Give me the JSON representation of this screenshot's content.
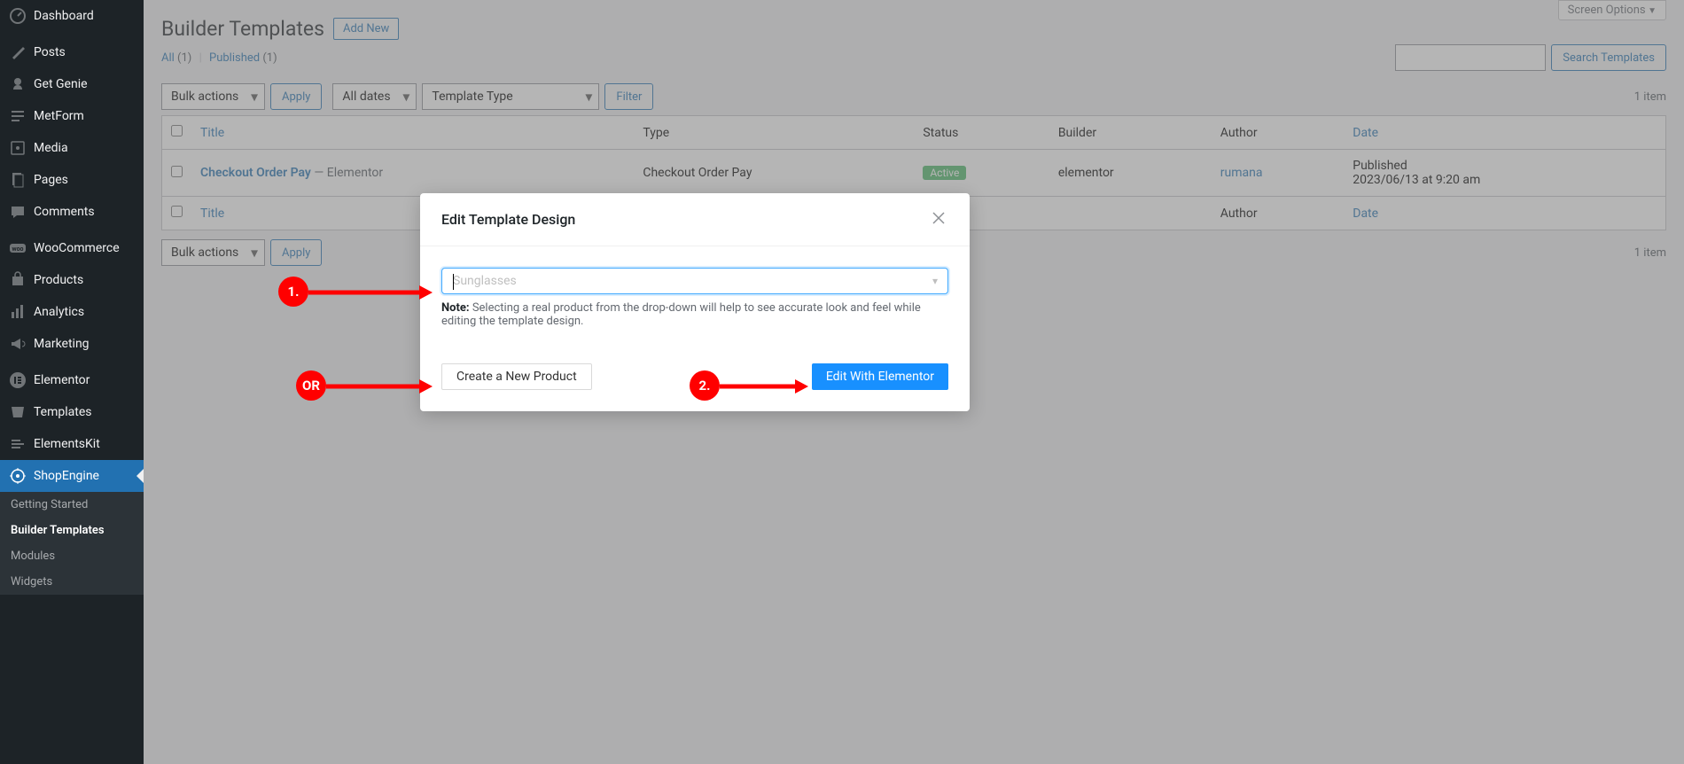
{
  "sidebar": {
    "items": [
      {
        "label": "Dashboard",
        "icon": "dashboard"
      },
      {
        "label": "Posts",
        "icon": "pin"
      },
      {
        "label": "Get Genie",
        "icon": "genie"
      },
      {
        "label": "MetForm",
        "icon": "form"
      },
      {
        "label": "Media",
        "icon": "media"
      },
      {
        "label": "Pages",
        "icon": "page"
      },
      {
        "label": "Comments",
        "icon": "comment"
      },
      {
        "label": "WooCommerce",
        "icon": "woo"
      },
      {
        "label": "Products",
        "icon": "product"
      },
      {
        "label": "Analytics",
        "icon": "analytics"
      },
      {
        "label": "Marketing",
        "icon": "marketing"
      },
      {
        "label": "Elementor",
        "icon": "elementor"
      },
      {
        "label": "Templates",
        "icon": "templates"
      },
      {
        "label": "ElementsKit",
        "icon": "ekit"
      },
      {
        "label": "ShopEngine",
        "icon": "shopengine",
        "active": true
      }
    ],
    "submenu": [
      {
        "label": "Getting Started"
      },
      {
        "label": "Builder Templates",
        "current": true
      },
      {
        "label": "Modules"
      },
      {
        "label": "Widgets"
      }
    ]
  },
  "header": {
    "title": "Builder Templates",
    "add_new": "Add New",
    "screen_options": "Screen Options"
  },
  "filters": {
    "all_label": "All",
    "all_count": "(1)",
    "separator": "|",
    "published_label": "Published",
    "published_count": "(1)"
  },
  "tablenav": {
    "bulk_actions": "Bulk actions",
    "apply": "Apply",
    "all_dates": "All dates",
    "template_type": "Template Type",
    "filter": "Filter",
    "item_count": "1 item"
  },
  "search": {
    "button": "Search Templates"
  },
  "table": {
    "headers": {
      "title": "Title",
      "type": "Type",
      "status": "Status",
      "builder": "Builder",
      "author": "Author",
      "date": "Date"
    },
    "row": {
      "title": "Checkout Order Pay",
      "title_suffix": " — Elementor",
      "type": "Checkout Order Pay",
      "status": "Active",
      "builder": "elementor",
      "author": "rumana",
      "date_label": "Published",
      "date_value": "2023/06/13 at 9:20 am"
    }
  },
  "modal": {
    "title": "Edit Template Design",
    "placeholder": "Sunglasses",
    "note_prefix": "Note:",
    "note_text": " Selecting a real product from the drop-down will help to see accurate look and feel while editing the template design.",
    "create_product": "Create a New Product",
    "edit_elementor": "Edit With Elementor"
  },
  "annotations": {
    "one": "1.",
    "two": "2.",
    "or": "OR"
  }
}
